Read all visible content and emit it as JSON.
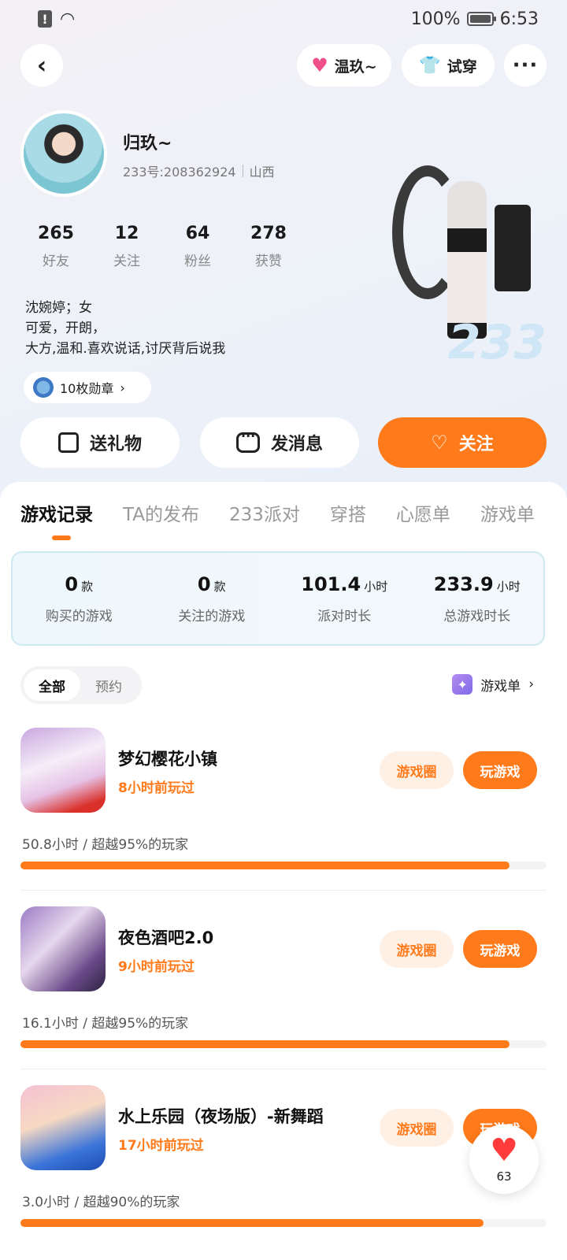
{
  "status_bar": {
    "battery": "100%",
    "time": "6:53"
  },
  "header": {
    "back_icon": "back-arrow-icon",
    "mood_label": "温玖~",
    "try_on_label": "试穿",
    "more_label": "···"
  },
  "profile": {
    "name": "归玖~",
    "uid": "233号:208362924",
    "region": "山西",
    "stats": [
      {
        "value": "265",
        "label": "好友"
      },
      {
        "value": "12",
        "label": "关注"
      },
      {
        "value": "64",
        "label": "粉丝"
      },
      {
        "value": "278",
        "label": "获赞"
      }
    ],
    "bio": [
      "沈婉婷；女",
      "可爱，开朗，",
      "大方,温和.喜欢说话,讨厌背后说我"
    ],
    "badges_label": "10枚勋章",
    "character_watermark": "233"
  },
  "actions": {
    "gift": "送礼物",
    "message": "发消息",
    "follow": "关注"
  },
  "tabs": [
    "游戏记录",
    "TA的发布",
    "233派对",
    "穿搭",
    "心愿单",
    "游戏单"
  ],
  "summary": [
    {
      "value": "0",
      "unit": "款",
      "label": "购买的游戏"
    },
    {
      "value": "0",
      "unit": "款",
      "label": "关注的游戏"
    },
    {
      "value": "101.4",
      "unit": "小时",
      "label": "派对时长"
    },
    {
      "value": "233.9",
      "unit": "小时",
      "label": "总游戏时长"
    }
  ],
  "filter": {
    "all": "全部",
    "reserved": "预约"
  },
  "game_list_link": "游戏单",
  "games": [
    {
      "title": "梦幻樱花小镇",
      "last_played": "8小时前玩过",
      "circle": "游戏圈",
      "play": "玩游戏",
      "stat": "50.8小时 / 超越95%的玩家",
      "progress": 0.93
    },
    {
      "title": "夜色酒吧2.0",
      "last_played": "9小时前玩过",
      "circle": "游戏圈",
      "play": "玩游戏",
      "stat": "16.1小时 / 超越95%的玩家",
      "progress": 0.93
    },
    {
      "title": "水上乐园（夜场版）-新舞蹈",
      "last_played": "17小时前玩过",
      "circle": "游戏圈",
      "play": "玩游戏",
      "stat": "3.0小时 / 超越90%的玩家",
      "progress": 0.88
    }
  ],
  "floating_like": {
    "count": "63"
  },
  "colors": {
    "accent": "#ff7a1a",
    "heart": "#ff3b3b"
  }
}
